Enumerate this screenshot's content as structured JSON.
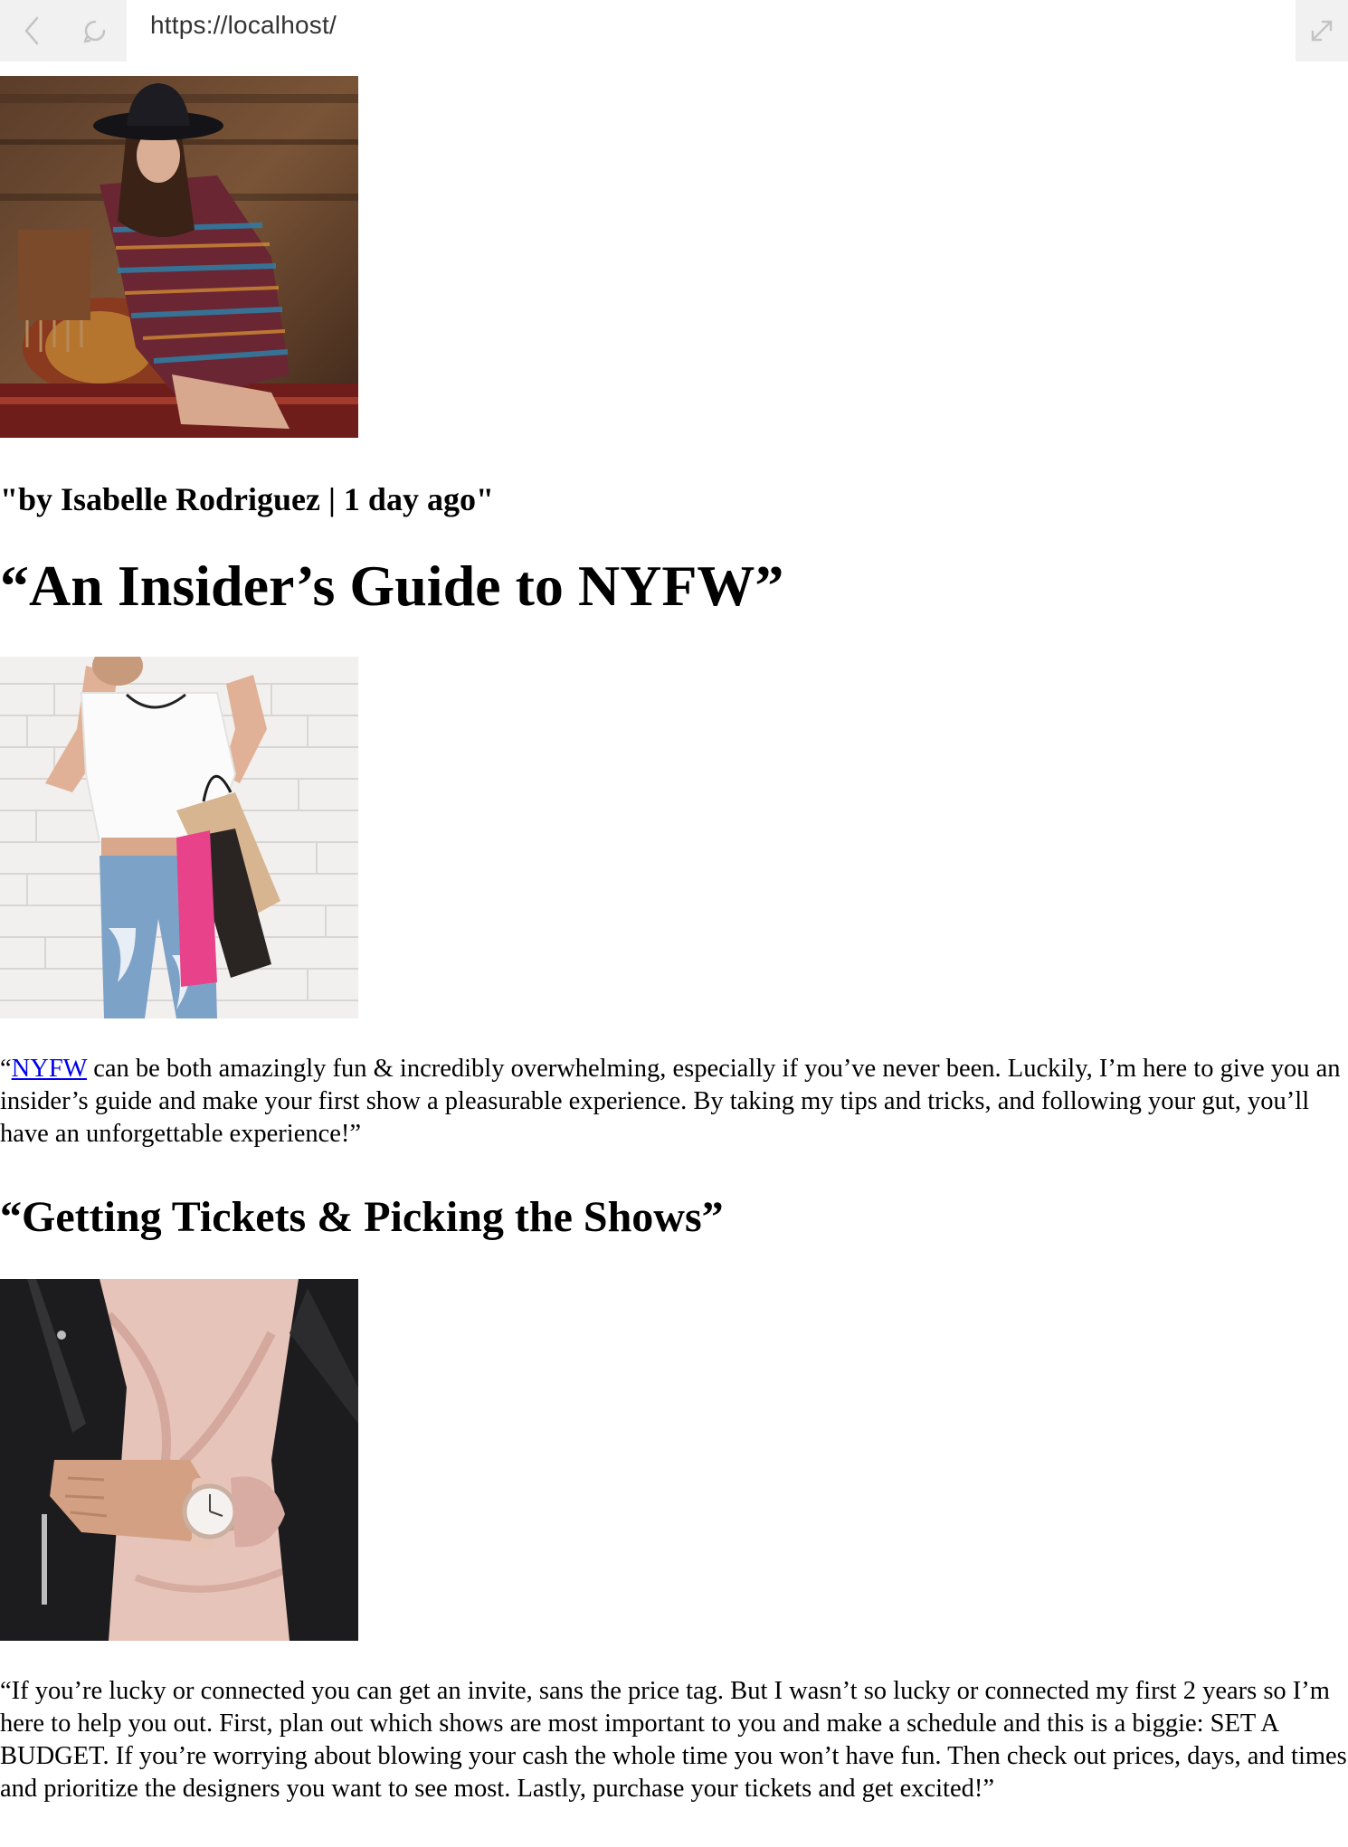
{
  "browser": {
    "url": "https://localhost/",
    "back_icon": "chevron-left-icon",
    "reload_icon": "reload-icon",
    "expand_icon": "expand-diagonal-icon"
  },
  "article": {
    "hero_image": "woman in black hat and striped knit dress seated on patterned cushions",
    "byline": "\"by Isabelle Rodriguez | 1 day ago\"",
    "title": "“An Insider’s Guide to NYFW”",
    "second_image": "woman in white tee and ripped jeans holding shopping bags against white brick wall",
    "intro": {
      "open_quote": "“",
      "link_text": "NYFW",
      "text": " can be both amazingly fun & incredibly overwhelming, especially if you’ve never been. Luckily, I’m here to give you an insider’s guide and make your first show a pleasurable experience. By taking my tips and tricks, and following your gut, you’ll have an unforgettable experience!”"
    },
    "section_heading": "“Getting Tickets & Picking the Shows”",
    "third_image": "woman in leather jacket and pink satin top wearing a wristwatch",
    "section_text": "“If you’re lucky or connected you can get an invite, sans the price tag. But I wasn’t so lucky or connected my first 2 years so I’m here to help you out. First, plan out which shows are most important to you and make a schedule and this is a biggie: SET A BUDGET. If you’re worrying about blowing your cash the whole time you won’t have fun. Then check out prices, days, and times and prioritize the designers you want to see most. Lastly, purchase your tickets and get excited!”"
  },
  "colors": {
    "link": "#0000ee",
    "chrome_bg": "#f1f1f1",
    "text": "#000000"
  }
}
